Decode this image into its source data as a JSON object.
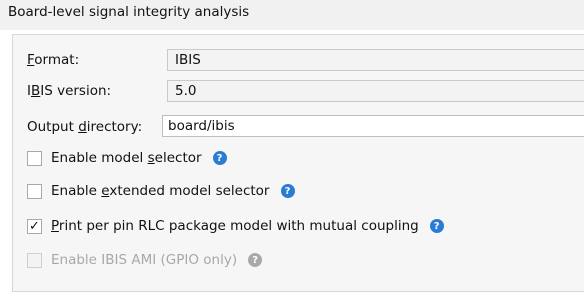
{
  "header": {
    "title": "Board-level signal integrity analysis"
  },
  "format": {
    "label_pre": "",
    "label_u": "F",
    "label_post": "ormat:",
    "value": "IBIS"
  },
  "ibis_version": {
    "label_pre": "I",
    "label_u": "B",
    "label_post": "IS version:",
    "value": "5.0"
  },
  "output_dir": {
    "label_pre": "Output ",
    "label_u": "d",
    "label_post": "irectory:",
    "value": "board/ibis"
  },
  "options": [
    {
      "pre": "Enable model ",
      "u": "s",
      "post": "elector",
      "checked": false,
      "disabled": false,
      "mark": ""
    },
    {
      "pre": "Enable ",
      "u": "e",
      "post": "xtended model selector",
      "checked": false,
      "disabled": false,
      "mark": ""
    },
    {
      "pre": "",
      "u": "P",
      "post": "rint per pin RLC package model with mutual coupling",
      "checked": true,
      "disabled": false,
      "mark": "✓"
    },
    {
      "pre": "Enable IBIS AMI (GPIO only)",
      "u": "",
      "post": "",
      "checked": false,
      "disabled": true,
      "mark": ""
    }
  ],
  "help_glyph": "?",
  "colors": {
    "help": "#2a7bd4",
    "help_disabled": "#a9a9a9",
    "disabled_text": "#a8a8a8"
  }
}
